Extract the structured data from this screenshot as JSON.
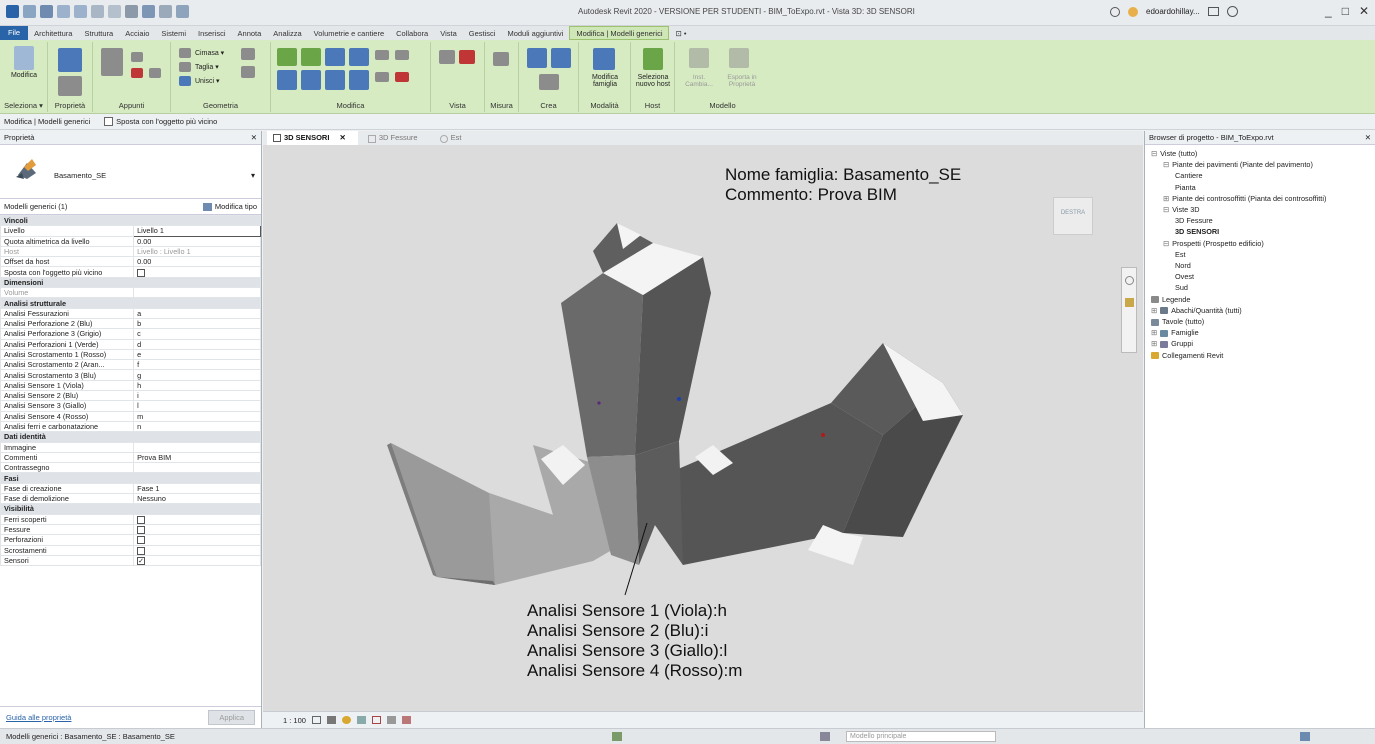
{
  "window": {
    "title": "Autodesk Revit 2020 - VERSIONE PER STUDENTI - BIM_ToExpo.rvt - Vista 3D: 3D SENSORI",
    "user": "edoardohillay...",
    "minimize": "_",
    "maximize": "□",
    "close": "✕"
  },
  "tabs": [
    "File",
    "Architettura",
    "Struttura",
    "Acciaio",
    "Sistemi",
    "Inserisci",
    "Annota",
    "Analizza",
    "Volumetrie e cantiere",
    "Collabora",
    "Vista",
    "Gestisci",
    "Moduli aggiuntivi",
    "Modifica | Modelli generici",
    "⊡ •"
  ],
  "ribbon": {
    "modifica_button": "Modifica",
    "groups": [
      "Seleziona ▾",
      "Proprietà",
      "Appunti",
      "Geometria",
      "Modifica",
      "Vista",
      "Misura",
      "Crea",
      "Modalità",
      "Host",
      "Modello"
    ],
    "clipboard": {
      "cut": "Taglia ▾",
      "join": "Unisci ▾",
      "cope": "Cimasa ▾"
    },
    "modifica_famiglia": "Modifica famiglia",
    "seleziona_host": "Seleziona nuovo host",
    "model_btn1": "Inst. Cambia...",
    "model_btn2": "Esporta in Proprietà"
  },
  "options_bar": {
    "context": "Modifica | Modelli generici",
    "sposta_label": "Sposta con l'oggetto più vicino"
  },
  "properties": {
    "header": "Proprietà",
    "close": "✕",
    "type_name": "Basamento_SE",
    "instance_filter": "Modelli generici (1)",
    "edit_type": "Modifica tipo",
    "groups": [
      {
        "name": "Vincoli",
        "rows": [
          {
            "label": "Livello",
            "value": "Livello 1"
          },
          {
            "label": "Quota altimetrica da livello",
            "value": "0.00"
          },
          {
            "label": "Host",
            "value": "Livello : Livello 1",
            "dim": true
          },
          {
            "label": "Offset da host",
            "value": "0.00"
          },
          {
            "label": "Sposta con l'oggetto più vicino",
            "check": "unchecked"
          }
        ]
      },
      {
        "name": "Dimensioni",
        "rows": [
          {
            "label": "Volume",
            "value": "",
            "dim": true
          }
        ]
      },
      {
        "name": "Analisi strutturale",
        "rows": [
          {
            "label": "Analisi Fessurazioni",
            "value": "a"
          },
          {
            "label": "Analisi Perforazione 2 (Blu)",
            "value": "b"
          },
          {
            "label": "Analisi Perforazione 3 (Grigio)",
            "value": "c"
          },
          {
            "label": "Analisi Perforazioni 1 (Verde)",
            "value": "d"
          },
          {
            "label": "Analisi Scrostamento 1 (Rosso)",
            "value": "e"
          },
          {
            "label": "Analisi Scrostamento 2 (Aran...",
            "value": "f"
          },
          {
            "label": "Analisi Scrostamento 3 (Blu)",
            "value": "g"
          },
          {
            "label": "Analisi Sensore 1 (Viola)",
            "value": "h"
          },
          {
            "label": "Analisi Sensore 2 (Blu)",
            "value": "i"
          },
          {
            "label": "Analisi Sensore 3 (Giallo)",
            "value": "l"
          },
          {
            "label": "Analisi Sensore 4 (Rosso)",
            "value": "m"
          },
          {
            "label": "Analisi ferri e carbonatazione",
            "value": "n"
          }
        ]
      },
      {
        "name": "Dati identità",
        "rows": [
          {
            "label": "Immagine",
            "value": ""
          },
          {
            "label": "Commenti",
            "value": "Prova BIM"
          },
          {
            "label": "Contrassegno",
            "value": ""
          }
        ]
      },
      {
        "name": "Fasi",
        "rows": [
          {
            "label": "Fase di creazione",
            "value": "Fase 1"
          },
          {
            "label": "Fase di demolizione",
            "value": "Nessuno"
          }
        ]
      },
      {
        "name": "Visibilità",
        "rows": [
          {
            "label": "Ferri scoperti",
            "check": "unchecked"
          },
          {
            "label": "Fessure",
            "check": "unchecked"
          },
          {
            "label": "Perforazioni",
            "check": "unchecked"
          },
          {
            "label": "Scrostamenti",
            "check": "unchecked"
          },
          {
            "label": "Sensori",
            "check": "checked"
          }
        ]
      }
    ],
    "help_link": "Guida alle proprietà",
    "apply": "Applica"
  },
  "view_tabs": [
    {
      "label": "3D SENSORI",
      "active": true,
      "close": "✕"
    },
    {
      "label": "3D Fessure",
      "active": false
    },
    {
      "label": "Est",
      "active": false
    }
  ],
  "canvas": {
    "annotation_top": [
      "Nome famiglia: Basamento_SE",
      "Commento: Prova BIM"
    ],
    "annotation_bottom": [
      "Analisi Sensore 1 (Viola):h",
      "Analisi Sensore 2 (Blu):i",
      "Analisi Sensore 3 (Giallo):l",
      "Analisi Sensore 4 (Rosso):m"
    ],
    "viewcube_label": "DESTRA"
  },
  "view_control": {
    "scale": "1 : 100"
  },
  "browser": {
    "header": "Browser di progetto - BIM_ToExpo.rvt",
    "close": "✕",
    "nodes": [
      {
        "label": "Viste (tutto)",
        "level": 0,
        "exp": "⊟"
      },
      {
        "label": "Piante dei pavimenti (Piante del pavimento)",
        "level": 1,
        "exp": "⊟"
      },
      {
        "label": "Cantiere",
        "level": 2
      },
      {
        "label": "Pianta",
        "level": 2
      },
      {
        "label": "Piante dei controsoffitti (Pianta dei controsoffitti)",
        "level": 1,
        "exp": "⊞"
      },
      {
        "label": "Viste 3D",
        "level": 1,
        "exp": "⊟"
      },
      {
        "label": "3D Fessure",
        "level": 2
      },
      {
        "label": "3D SENSORI",
        "level": 2,
        "bold": true
      },
      {
        "label": "Prospetti (Prospetto edificio)",
        "level": 1,
        "exp": "⊟"
      },
      {
        "label": "Est",
        "level": 2
      },
      {
        "label": "Nord",
        "level": 2
      },
      {
        "label": "Ovest",
        "level": 2
      },
      {
        "label": "Sud",
        "level": 2
      },
      {
        "label": "Legende",
        "level": 0,
        "icon": "legend-icon"
      },
      {
        "label": "Abachi/Quantità (tutti)",
        "level": 0,
        "exp": "⊞",
        "icon": "schedule-icon"
      },
      {
        "label": "Tavole (tutto)",
        "level": 0,
        "icon": "sheet-icon"
      },
      {
        "label": "Famiglie",
        "level": 0,
        "exp": "⊞",
        "icon": "family-icon"
      },
      {
        "label": "Gruppi",
        "level": 0,
        "exp": "⊞",
        "icon": "group-icon"
      },
      {
        "label": "Collegamenti Revit",
        "level": 0,
        "icon": "link-icon"
      }
    ]
  },
  "status": {
    "text": "Modelli generici : Basamento_SE : Basamento_SE",
    "model": "Modello principale"
  }
}
